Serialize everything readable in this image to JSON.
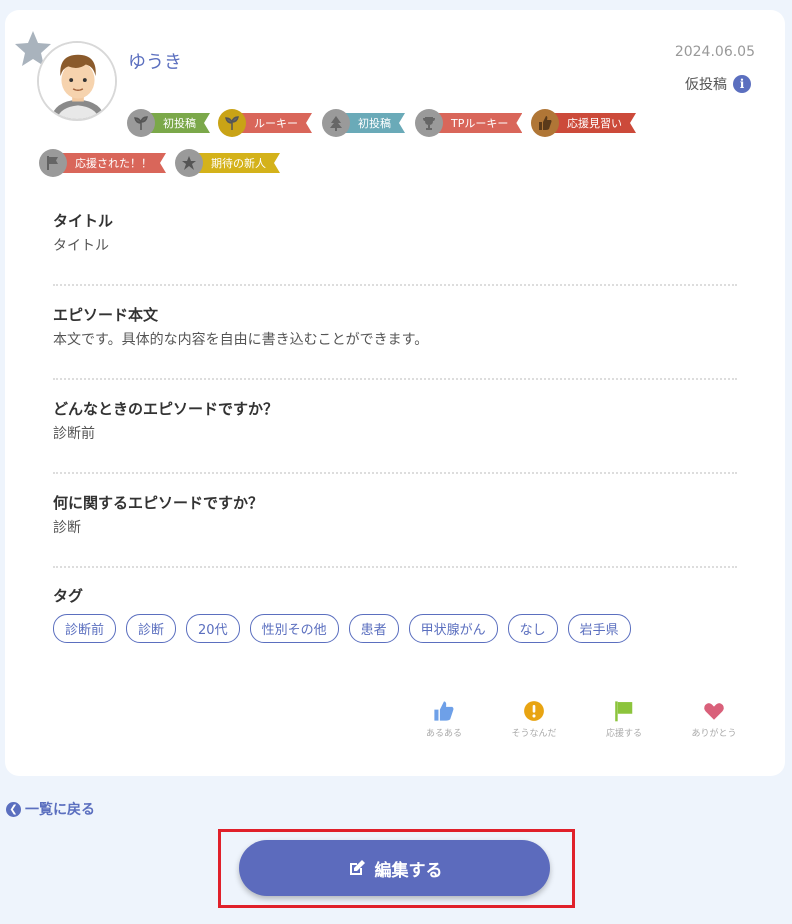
{
  "post": {
    "username": "ゆうき",
    "date": "2024.06.05",
    "draft_label": "仮投稿",
    "info_icon_glyph": "i"
  },
  "badges": [
    {
      "icon": "sprout-icon",
      "label": "初投稿",
      "color": "#7ba84a"
    },
    {
      "icon": "sprout-icon",
      "label": "ルーキー",
      "color": "#d9665a"
    },
    {
      "icon": "tree-icon",
      "label": "初投稿",
      "color": "#6aaab8"
    },
    {
      "icon": "trophy-icon",
      "label": "TPルーキー",
      "color": "#d9665a"
    },
    {
      "icon": "thumbs-up-icon",
      "label": "応援見習い",
      "color": "#cc4a3a"
    },
    {
      "icon": "flag-icon",
      "label": "応援された！！",
      "color": "#d9665a"
    },
    {
      "icon": "star-icon",
      "label": "期待の新人",
      "color": "#d4b21a"
    }
  ],
  "sections": {
    "title": {
      "heading": "タイトル",
      "value": "タイトル"
    },
    "body": {
      "heading": "エピソード本文",
      "value": "本文です。具体的な内容を自由に書き込むことができます。"
    },
    "when": {
      "heading": "どんなときのエピソードですか？",
      "value": "診断前"
    },
    "about": {
      "heading": "何に関するエピソードですか？",
      "value": "診断"
    },
    "tags": {
      "heading": "タグ",
      "items": [
        "診断前",
        "診断",
        "20代",
        "性別その他",
        "患者",
        "甲状腺がん",
        "なし",
        "岩手県"
      ]
    }
  },
  "reactions": [
    {
      "label": "あるある",
      "icon": "thumbs-up-icon",
      "color": "#6ea0e8"
    },
    {
      "label": "そうなんだ",
      "icon": "exclamation-icon",
      "color": "#e8a412"
    },
    {
      "label": "応援する",
      "icon": "flag-icon",
      "color": "#8cc43c"
    },
    {
      "label": "ありがとう",
      "icon": "heart-icon",
      "color": "#d9607a"
    }
  ],
  "nav": {
    "back_label": "一覧に戻る",
    "edit_label": "編集する"
  },
  "colors": {
    "accent": "#5c6bbd",
    "highlight": "#e0202a",
    "background": "#eef4fc"
  }
}
